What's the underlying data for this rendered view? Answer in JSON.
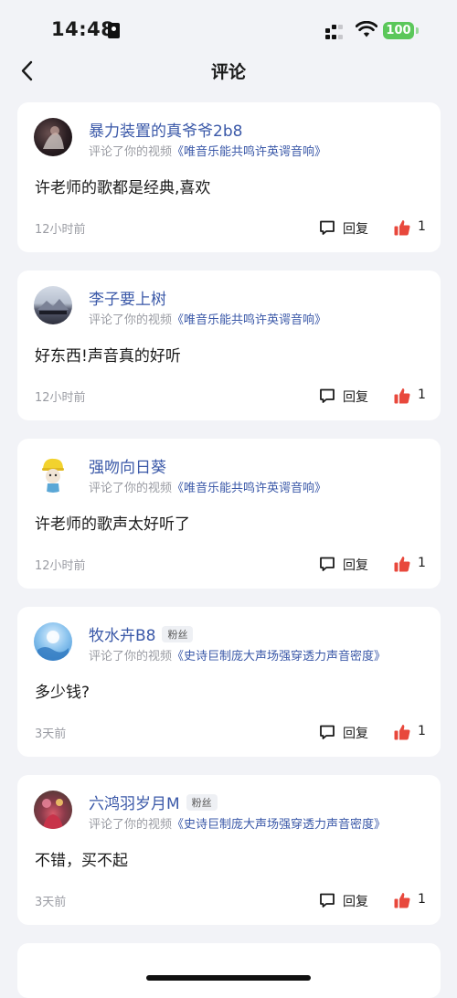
{
  "status_bar": {
    "time": "14:48",
    "battery": "100"
  },
  "nav": {
    "title": "评论",
    "back_icon": "chevron-left-icon"
  },
  "comments": [
    {
      "username": "暴力装置的真爷爷2b8",
      "badge": "",
      "action": "评论了你的视频",
      "video": "《唯音乐能共鸣许英谔音响》",
      "text": "许老师的歌都是经典,喜欢",
      "time": "12小时前",
      "reply_label": "回复",
      "likes": "1"
    },
    {
      "username": "李子要上树",
      "badge": "",
      "action": "评论了你的视频",
      "video": "《唯音乐能共鸣许英谔音响》",
      "text": "好东西!声音真的好听",
      "time": "12小时前",
      "reply_label": "回复",
      "likes": "1"
    },
    {
      "username": "强吻向日葵",
      "badge": "",
      "action": "评论了你的视频",
      "video": "《唯音乐能共鸣许英谔音响》",
      "text": "许老师的歌声太好听了",
      "time": "12小时前",
      "reply_label": "回复",
      "likes": "1"
    },
    {
      "username": "牧水卉B8",
      "badge": "粉丝",
      "action": "评论了你的视频",
      "video": "《史诗巨制庞大声场强穿透力声音密度》",
      "text": "多少钱?",
      "time": "3天前",
      "reply_label": "回复",
      "likes": "1"
    },
    {
      "username": "六鸿羽岁月M",
      "badge": "粉丝",
      "action": "评论了你的视频",
      "video": "《史诗巨制庞大声场强穿透力声音密度》",
      "text": "不错，买不起",
      "time": "3天前",
      "reply_label": "回复",
      "likes": "1"
    }
  ],
  "colors": {
    "accent": "#3a58a8",
    "like": "#e8483c",
    "background": "#f2f3f7",
    "muted": "#9a9ca3"
  }
}
